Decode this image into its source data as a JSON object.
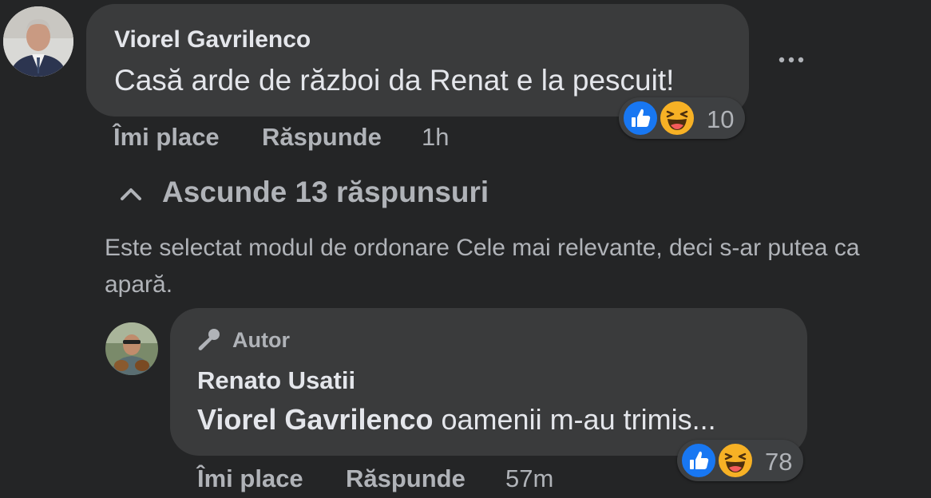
{
  "comment": {
    "author": "Viorel Gavrilenco",
    "text": "Casă arde de război da Renat e la pescuit!",
    "reaction_count": "10",
    "like_label": "Îmi place",
    "reply_label": "Răspunde",
    "time": "1h"
  },
  "replies_toggle": {
    "label": "Ascunde 13 răspunsuri"
  },
  "sort_notice": "Este selectat modul de ordonare Cele mai relevante, deci s-ar putea ca\napară.",
  "reply": {
    "badge": "Autor",
    "author": "Renato Usatii",
    "mention": "Viorel Gavrilenco",
    "text": "oamenii m-au trimis...",
    "reaction_count": "78",
    "like_label": "Îmi place",
    "reply_label": "Răspunde",
    "time": "57m"
  },
  "colors": {
    "background": "#242526",
    "bubble": "#3a3b3c",
    "like_blue": "#1877f2",
    "haha_yellow": "#f7b125"
  },
  "icons": [
    "more-icon",
    "like-reaction-icon",
    "haha-reaction-icon",
    "chevron-up-icon",
    "microphone-icon"
  ]
}
